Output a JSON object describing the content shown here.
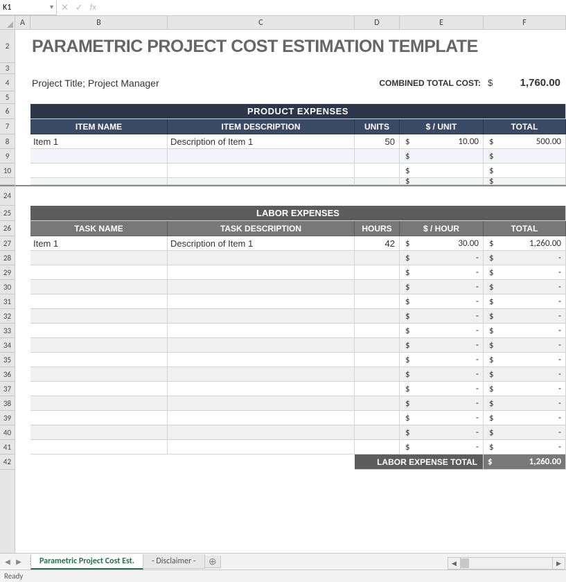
{
  "formula_bar": {
    "name_box": "K1",
    "formula": ""
  },
  "columns": [
    "A",
    "B",
    "C",
    "D",
    "E",
    "F"
  ],
  "row_nums_a": [
    "2",
    "3",
    "4",
    "5",
    "6",
    "7",
    "8",
    "9",
    "10"
  ],
  "row_nums_b": [
    "24",
    "25",
    "26",
    "27",
    "28",
    "29",
    "30",
    "31",
    "32",
    "33",
    "34",
    "35",
    "36",
    "37",
    "38",
    "39",
    "40",
    "41",
    "42"
  ],
  "title": "PARAMETRIC PROJECT COST ESTIMATION TEMPLATE",
  "subtitle": "Project Title; Project Manager",
  "combined_label": "COMBINED TOTAL COST:",
  "combined_dollar": "$",
  "combined_value": "1,760.00",
  "product": {
    "header": "PRODUCT EXPENSES",
    "cols": [
      "ITEM NAME",
      "ITEM DESCRIPTION",
      "UNITS",
      "$ / UNIT",
      "TOTAL"
    ],
    "rows": [
      {
        "name": "Item 1",
        "desc": "Description of Item 1",
        "units": "50",
        "d1": "$",
        "unit_price": "10.00",
        "d2": "$",
        "total": "500.00"
      },
      {
        "name": "",
        "desc": "",
        "units": "",
        "d1": "$",
        "unit_price": "",
        "d2": "$",
        "total": ""
      },
      {
        "name": "",
        "desc": "",
        "units": "",
        "d1": "$",
        "unit_price": "",
        "d2": "$",
        "total": ""
      }
    ]
  },
  "labor": {
    "header": "LABOR EXPENSES",
    "cols": [
      "TASK NAME",
      "TASK DESCRIPTION",
      "HOURS",
      "$ / HOUR",
      "TOTAL"
    ],
    "rows": [
      {
        "name": "Item 1",
        "desc": "Description of Item 1",
        "hours": "42",
        "d1": "$",
        "rate": "30.00",
        "d2": "$",
        "total": "1,260.00"
      },
      {
        "name": "",
        "desc": "",
        "hours": "",
        "d1": "$",
        "rate": "-",
        "d2": "$",
        "total": "-"
      },
      {
        "name": "",
        "desc": "",
        "hours": "",
        "d1": "$",
        "rate": "-",
        "d2": "$",
        "total": "-"
      },
      {
        "name": "",
        "desc": "",
        "hours": "",
        "d1": "$",
        "rate": "-",
        "d2": "$",
        "total": "-"
      },
      {
        "name": "",
        "desc": "",
        "hours": "",
        "d1": "$",
        "rate": "-",
        "d2": "$",
        "total": "-"
      },
      {
        "name": "",
        "desc": "",
        "hours": "",
        "d1": "$",
        "rate": "-",
        "d2": "$",
        "total": "-"
      },
      {
        "name": "",
        "desc": "",
        "hours": "",
        "d1": "$",
        "rate": "-",
        "d2": "$",
        "total": "-"
      },
      {
        "name": "",
        "desc": "",
        "hours": "",
        "d1": "$",
        "rate": "-",
        "d2": "$",
        "total": "-"
      },
      {
        "name": "",
        "desc": "",
        "hours": "",
        "d1": "$",
        "rate": "-",
        "d2": "$",
        "total": "-"
      },
      {
        "name": "",
        "desc": "",
        "hours": "",
        "d1": "$",
        "rate": "-",
        "d2": "$",
        "total": "-"
      },
      {
        "name": "",
        "desc": "",
        "hours": "",
        "d1": "$",
        "rate": "-",
        "d2": "$",
        "total": "-"
      },
      {
        "name": "",
        "desc": "",
        "hours": "",
        "d1": "$",
        "rate": "-",
        "d2": "$",
        "total": "-"
      },
      {
        "name": "",
        "desc": "",
        "hours": "",
        "d1": "$",
        "rate": "-",
        "d2": "$",
        "total": "-"
      },
      {
        "name": "",
        "desc": "",
        "hours": "",
        "d1": "$",
        "rate": "-",
        "d2": "$",
        "total": "-"
      },
      {
        "name": "",
        "desc": "",
        "hours": "",
        "d1": "$",
        "rate": "-",
        "d2": "$",
        "total": "-"
      }
    ],
    "total_label": "LABOR EXPENSE TOTAL",
    "total_d": "$",
    "total_val": "1,260.00"
  },
  "tabs": {
    "active": "Parametric Project Cost Est.",
    "inactive": "- Disclaimer -"
  },
  "status": "Ready"
}
